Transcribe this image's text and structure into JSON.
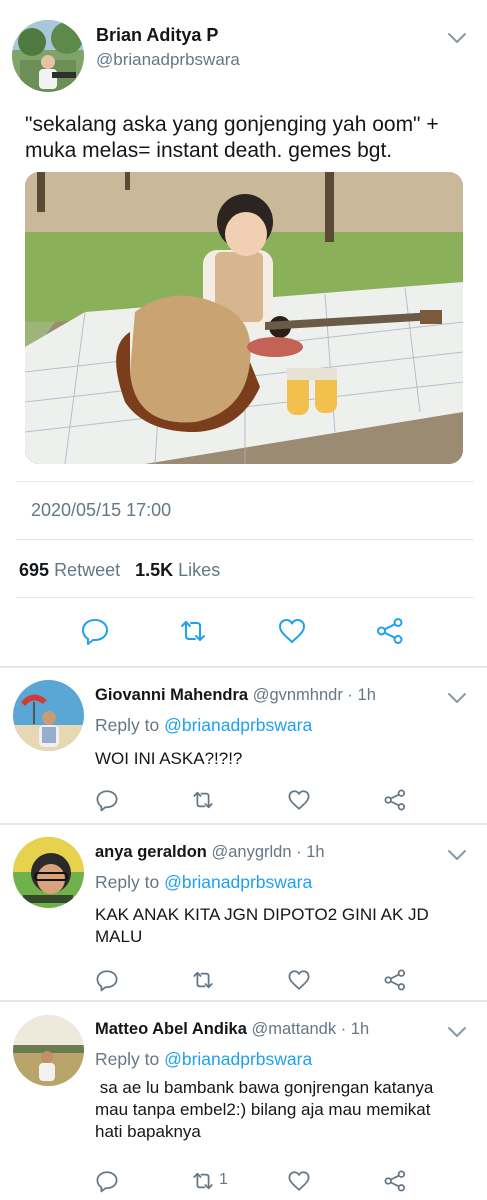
{
  "tweet": {
    "author_name": "Brian Aditya P",
    "author_handle": "@brianadprbswara",
    "text_line1": "\"sekalang aska yang gonjenging yah oom\" +",
    "text_line2": "muka melas= instant death. gemes bgt.",
    "timestamp": "2020/05/15 17:00",
    "retweet_count": "695",
    "retweet_label": "Retweet",
    "like_count": "1.5K",
    "like_label": "Likes",
    "photo_icon": "photo-child-with-guitar"
  },
  "replies": [
    {
      "name": "Giovanni Mahendra",
      "handle": "@gvnmhndr",
      "sep": "·",
      "time": "1h",
      "reply_to_label": "Reply to",
      "reply_to_handle": "@brianadprbswara",
      "text": "WOI INI ASKA?!?!?",
      "retweet_count": ""
    },
    {
      "name": "anya geraldon",
      "handle": "@anygrldn",
      "sep": "·",
      "time": "1h",
      "reply_to_label": "Reply to",
      "reply_to_handle": "@brianadprbswara",
      "text_line1": "KAK ANAK KITA JGN DIPOTO2 GINI AK JD",
      "text_line2": "MALU",
      "retweet_count": ""
    },
    {
      "name": "Matteo Abel Andika",
      "handle": "@mattandk",
      "sep": "·",
      "time": "1h",
      "reply_to_label": "Reply to",
      "reply_to_handle": "@brianadprbswara",
      "text_line1": " sa ae lu bambank bawa gonjrengan katanya",
      "text_line2": "mau tanpa embel2:) bilang aja mau memikat",
      "text_line3": "hati bapaknya",
      "retweet_count": "1"
    }
  ],
  "colors": {
    "accent": "#1da1f2",
    "secondary_text": "#657786",
    "divider": "#e1e8ed",
    "icon": "#657786"
  }
}
